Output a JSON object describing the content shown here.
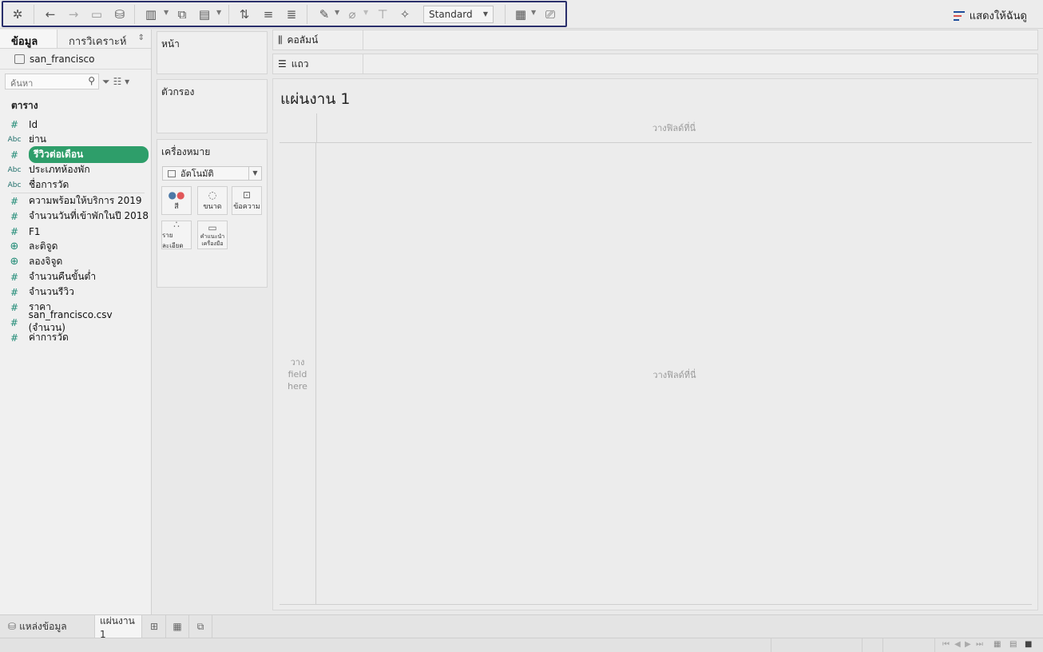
{
  "toolbar": {
    "view_mode": "Standard",
    "show_me": "แสดงให้ฉันดู"
  },
  "data_pane": {
    "tabs": [
      "ข้อมูล",
      "การวิเคราะห์"
    ],
    "datasource": "san_francisco",
    "search_placeholder": "ค้นหา",
    "section_title": "ตาราง",
    "fields": [
      {
        "type": "#",
        "label": "Id"
      },
      {
        "type": "Abc",
        "label": "ย่าน"
      },
      {
        "type": "#",
        "label": "รีวิวต่อเดือน"
      },
      {
        "type": "Abc",
        "label": "ประเภทห้องพัก"
      },
      {
        "type": "Abc",
        "label": "ชื่อการวัด"
      },
      {
        "type": "#",
        "label": "ความพร้อมให้บริการ 2019"
      },
      {
        "type": "#",
        "label": "จำนวนวันที่เข้าพักในปี 2018"
      },
      {
        "type": "#",
        "label": "F1"
      },
      {
        "type": "globe",
        "label": "ละติจูด"
      },
      {
        "type": "globe",
        "label": "ลองจิจูด"
      },
      {
        "type": "#",
        "label": "จำนวนคืนขั้นต่ำ"
      },
      {
        "type": "#",
        "label": "จำนวนรีวิว"
      },
      {
        "type": "#",
        "label": "ราคา"
      },
      {
        "type": "#",
        "label": "san_francisco.csv (จำนวน)"
      },
      {
        "type": "#",
        "label": "ค่าการวัด"
      }
    ]
  },
  "cards": {
    "pages": "หน้า",
    "filters": "ตัวกรอง",
    "marks": "เครื่องหมาย",
    "mark_type": "อัตโนมัติ",
    "mark_buttons": [
      "สี",
      "ขนาด",
      "ข้อความ",
      "รายละเอียด",
      "คำแนะนำเครื่องมือ"
    ]
  },
  "shelves": {
    "columns": "คอลัมน์",
    "rows": "แถว"
  },
  "canvas": {
    "sheet_title": "แผ่นงาน 1",
    "drop_top": "วางฟิลด์ที่นี่",
    "drop_left_1": "วาง",
    "drop_left_2": "field",
    "drop_left_3": "here",
    "drop_main": "วางฟิลด์ที่นี่"
  },
  "sheetbar": {
    "datasource_tab": "แหล่งข้อมูล",
    "sheet_tab": "แผ่นงาน 1"
  }
}
